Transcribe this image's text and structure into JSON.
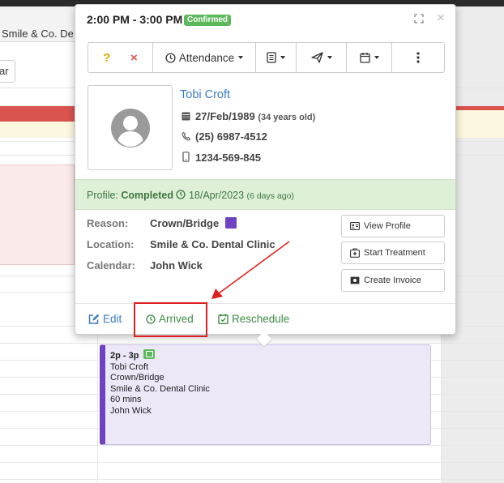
{
  "background": {
    "tab_text": "Smile & Co. De",
    "button_fragment": "ar"
  },
  "appointment_block": {
    "time": "2p - 3p",
    "patient": "Tobi Croft",
    "reason": "Crown/Bridge",
    "location": "Smile & Co. Dental Clinic",
    "duration": "60 mins",
    "provider": "John Wick"
  },
  "popover": {
    "time_range": "2:00 PM - 3:00 PM",
    "status_badge": "Confirmed",
    "toolbar": {
      "attendance_label": "Attendance"
    },
    "patient": {
      "name": "Tobi Croft",
      "dob": "27/Feb/1989",
      "age": "(34 years old)",
      "phone": "(25) 6987-4512",
      "mobile": "1234-569-845"
    },
    "profile": {
      "label": "Profile:",
      "status": "Completed",
      "date": "18/Apr/2023",
      "ago": "(6 days ago)"
    },
    "details": [
      {
        "label": "Reason:",
        "value": "Crown/Bridge"
      },
      {
        "label": "Location:",
        "value": "Smile & Co. Dental Clinic"
      },
      {
        "label": "Calendar:",
        "value": "John Wick"
      }
    ],
    "side_buttons": {
      "view_profile": "View Profile",
      "start_treatment": "Start Treatment",
      "create_invoice": "Create Invoice"
    },
    "footer": {
      "edit": "Edit",
      "arrived": "Arrived",
      "reschedule": "Reschedule"
    }
  },
  "colors": {
    "confirmed": "#5cb85c",
    "reason_swatch": "#6f42c1",
    "link_blue": "#3a7bbf",
    "link_green": "#3c8d40",
    "annotation_red": "#e02020"
  }
}
